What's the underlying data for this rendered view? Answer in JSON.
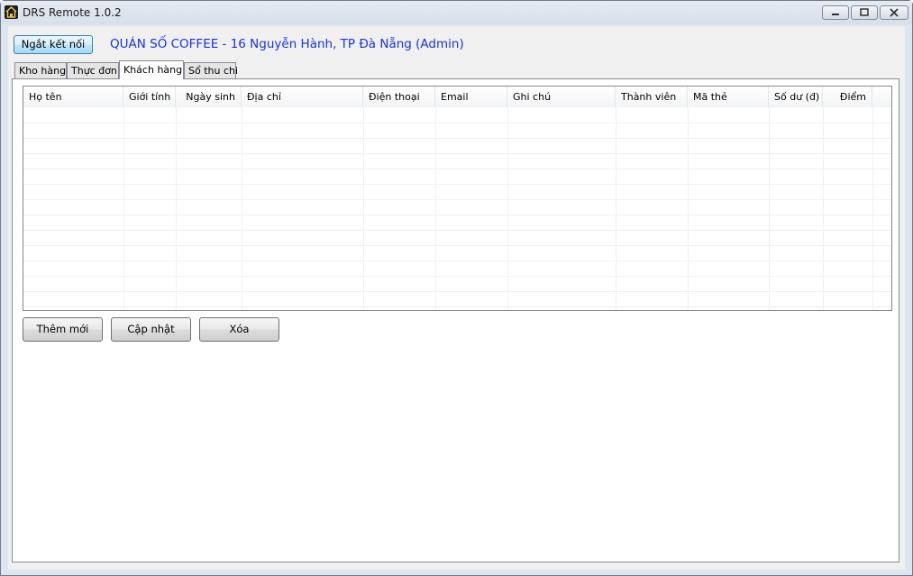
{
  "window": {
    "title": "DRS Remote 1.0.2"
  },
  "toolbar": {
    "connect_label": "Ngắt kết nối",
    "shop_title": "QUÁN SỐ COFFEE - 16 Nguyễn Hành, TP Đà Nẵng  (Admin)"
  },
  "tabs": [
    {
      "label": "Kho hàng"
    },
    {
      "label": "Thực đơn"
    },
    {
      "label": "Khách hàng"
    },
    {
      "label": "Sổ thu chi"
    }
  ],
  "active_tab": "Khách hàng",
  "table": {
    "columns": [
      "Họ tên",
      "Giới tính",
      "Ngày sinh",
      "Địa chỉ",
      "Điện thoại",
      "Email",
      "Ghi chú",
      "Thành viên",
      "Mã thẻ",
      "Số dư (đ)",
      "Điểm"
    ],
    "rows": []
  },
  "actions": {
    "add_label": "Thêm mới",
    "update_label": "Cập nhật",
    "delete_label": "Xóa"
  },
  "colors": {
    "title_text": "#1a33d6",
    "connect_button": "#bee6fd"
  },
  "icons": {
    "app": "app-home-icon",
    "minimize": "minimize-icon",
    "maximize": "maximize-icon",
    "close": "close-icon"
  }
}
